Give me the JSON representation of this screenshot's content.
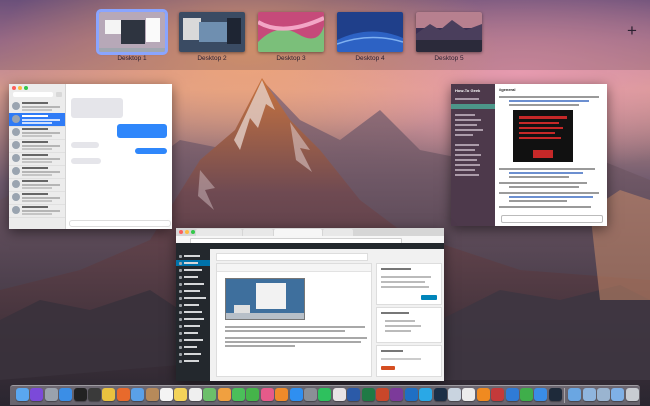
{
  "mission_control": {
    "desktops": [
      {
        "label": "Desktop 1",
        "active": true
      },
      {
        "label": "Desktop 2",
        "active": false
      },
      {
        "label": "Desktop 3",
        "active": false
      },
      {
        "label": "Desktop 4",
        "active": false
      },
      {
        "label": "Desktop 5",
        "active": false
      }
    ],
    "add_desktop_symbol": "+"
  },
  "windows": {
    "messages": {
      "app": "Messages"
    },
    "slack": {
      "app": "Slack",
      "team": "How-To Geek",
      "channel": "#general"
    },
    "browser": {
      "app": "Chrome",
      "content": "WordPress editor"
    }
  },
  "dock": {
    "icons": [
      {
        "name": "finder-icon",
        "color": "#5aa7f0"
      },
      {
        "name": "siri-icon",
        "color": "#7b4ad9"
      },
      {
        "name": "launchpad-icon",
        "color": "#9aa2ad"
      },
      {
        "name": "safari-icon",
        "color": "#3b8ee6"
      },
      {
        "name": "terminal-icon",
        "color": "#222222"
      },
      {
        "name": "activity-monitor-icon",
        "color": "#3a3a3a"
      },
      {
        "name": "chrome-icon",
        "color": "#e9c23f"
      },
      {
        "name": "firefox-icon",
        "color": "#e86a2c"
      },
      {
        "name": "mail-icon",
        "color": "#5aa0e8"
      },
      {
        "name": "contacts-icon",
        "color": "#b78a5a"
      },
      {
        "name": "calendar-icon",
        "color": "#f4f4f4"
      },
      {
        "name": "notes-icon",
        "color": "#f3d35a"
      },
      {
        "name": "reminders-icon",
        "color": "#efefef"
      },
      {
        "name": "maps-icon",
        "color": "#6cbf6a"
      },
      {
        "name": "photos-icon",
        "color": "#f0a040"
      },
      {
        "name": "messages-icon",
        "color": "#4bbf5a"
      },
      {
        "name": "facetime-icon",
        "color": "#45b44a"
      },
      {
        "name": "itunes-icon",
        "color": "#e65a8a"
      },
      {
        "name": "ibooks-icon",
        "color": "#f08a2a"
      },
      {
        "name": "app-store-icon",
        "color": "#2f8ff0"
      },
      {
        "name": "system-preferences-icon",
        "color": "#8a8f96"
      },
      {
        "name": "spotify-icon",
        "color": "#2ec15e"
      },
      {
        "name": "slack-icon",
        "color": "#e8e3e6"
      },
      {
        "name": "word-icon",
        "color": "#2b5aa8"
      },
      {
        "name": "excel-icon",
        "color": "#1f7a45"
      },
      {
        "name": "powerpoint-icon",
        "color": "#c9472a"
      },
      {
        "name": "onenote-icon",
        "color": "#7c3a9a"
      },
      {
        "name": "outlook-icon",
        "color": "#1f6fc4"
      },
      {
        "name": "skype-icon",
        "color": "#2aa8e6"
      },
      {
        "name": "photoshop-icon",
        "color": "#1b2f47"
      },
      {
        "name": "preview-icon",
        "color": "#c9d4e0"
      },
      {
        "name": "textedit-icon",
        "color": "#ececec"
      },
      {
        "name": "vlc-icon",
        "color": "#f08a20"
      },
      {
        "name": "transmission-icon",
        "color": "#c43a3a"
      },
      {
        "name": "1password-icon",
        "color": "#2f7bd6"
      },
      {
        "name": "evernote-icon",
        "color": "#3fae4a"
      },
      {
        "name": "dropbox-icon",
        "color": "#3a8de6"
      },
      {
        "name": "steam-icon",
        "color": "#1e2a3a"
      },
      {
        "name": "downloads-stack-icon",
        "color": "#6aa6e2"
      },
      {
        "name": "documents-stack-icon",
        "color": "#8fb5de"
      },
      {
        "name": "applications-stack-icon",
        "color": "#9ab4d0"
      },
      {
        "name": "folder-stack-icon",
        "color": "#7fb0e6"
      },
      {
        "name": "trash-icon",
        "color": "#c8ccd2"
      }
    ]
  }
}
